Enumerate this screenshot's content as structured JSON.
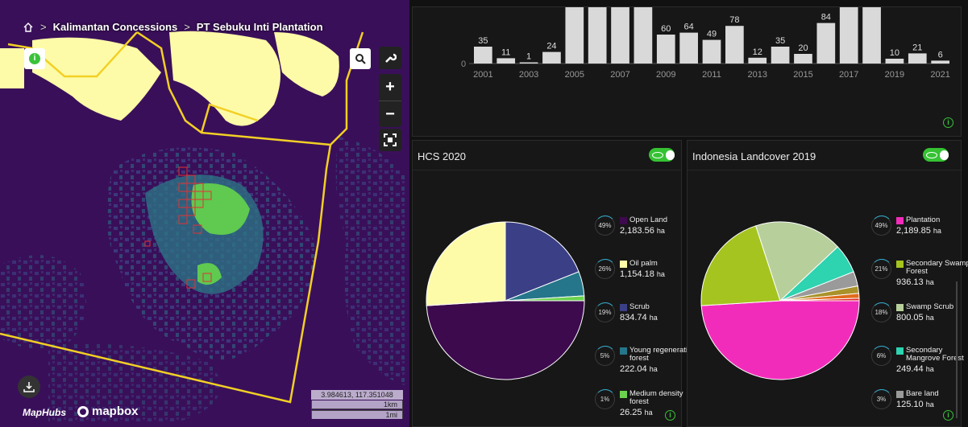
{
  "breadcrumb": {
    "home_icon": "home-icon",
    "items": [
      "Kalimantan Concessions",
      "PT Sebuku Inti Plantation"
    ],
    "separator": ">"
  },
  "map": {
    "coords": "3.984613, 117.351048",
    "scale_km": "1km",
    "scale_mi": "1mi",
    "logo_maphubs": "MapHubs",
    "logo_mapbox": "mapbox",
    "zoom_in": "+",
    "zoom_out": "−",
    "info_label": "i"
  },
  "bar_chart": {
    "chart_data": {
      "type": "bar",
      "categories": [
        "2001",
        "2002",
        "2003",
        "2004",
        "2005",
        "2006",
        "2007",
        "2008",
        "2009",
        "2010",
        "2011",
        "2012",
        "2013",
        "2014",
        "2015",
        "2016",
        "2017",
        "2018",
        "2019",
        "2020",
        "2021"
      ],
      "values": [
        35,
        11,
        1,
        24,
        null,
        null,
        null,
        null,
        60,
        64,
        49,
        78,
        12,
        35,
        20,
        84,
        null,
        null,
        10,
        21,
        6
      ],
      "labels": [
        "35",
        "11",
        "1",
        "24",
        "",
        "",
        "",
        "",
        "60",
        "64",
        "49",
        "78",
        "12",
        "35",
        "20",
        "84",
        "",
        "",
        "10",
        "21",
        "6"
      ],
      "xticks": [
        "2001",
        "2003",
        "2005",
        "2007",
        "2009",
        "2011",
        "2013",
        "2015",
        "2017",
        "2019",
        "2021"
      ],
      "ytick": "0",
      "clipped_note": "bars for 2005–2008 and 2017–2018 exceed visible range"
    }
  },
  "hcs": {
    "title": "HCS 2020",
    "chart_data": {
      "type": "pie",
      "slices": [
        {
          "label": "Open Land",
          "pct": 49,
          "value": "2,183.56",
          "unit": "ha",
          "color": "#3d0a4e"
        },
        {
          "label": "Oil palm",
          "pct": 26,
          "value": "1,154.18",
          "unit": "ha",
          "color": "#fdfba8"
        },
        {
          "label": "Scrub",
          "pct": 19,
          "value": "834.74",
          "unit": "ha",
          "color": "#3b3f86"
        },
        {
          "label": "Young regenerating forest",
          "pct": 5,
          "value": "222.04",
          "unit": "ha",
          "color": "#25768a"
        },
        {
          "label": "Medium density forest",
          "pct": 1,
          "value": "26.25",
          "unit": "ha",
          "color": "#6bd24e"
        }
      ]
    },
    "legend": [
      {
        "pct": "49%",
        "name": "Open Land",
        "value": "2,183.56",
        "unit": "ha"
      },
      {
        "pct": "26%",
        "name": "Oil palm",
        "value": "1,154.18",
        "unit": "ha"
      },
      {
        "pct": "19%",
        "name": "Scrub",
        "value": "834.74",
        "unit": "ha"
      },
      {
        "pct": "5%",
        "name": "Young regenerating forest",
        "value": "222.04",
        "unit": "ha"
      },
      {
        "pct": "1%",
        "name": "Medium density forest",
        "value": "26.25",
        "unit": "ha"
      }
    ]
  },
  "landcover": {
    "title": "Indonesia Landcover 2019",
    "chart_data": {
      "type": "pie",
      "slices": [
        {
          "label": "Plantation",
          "pct": 49,
          "value": "2,189.85",
          "unit": "ha",
          "color": "#f22cba"
        },
        {
          "label": "Secondary Swamp Forest",
          "pct": 21,
          "value": "936.13",
          "unit": "ha",
          "color": "#a5c41f"
        },
        {
          "label": "Swamp Scrub",
          "pct": 18,
          "value": "800.05",
          "unit": "ha",
          "color": "#b7cf9b"
        },
        {
          "label": "Secondary Mangrove Forest",
          "pct": 6,
          "value": "249.44",
          "unit": "ha",
          "color": "#2ed3b0"
        },
        {
          "label": "Bare land",
          "pct": 3,
          "value": "125.10",
          "unit": "ha",
          "color": "#9a9a9a"
        },
        {
          "label": "",
          "pct": 1.5,
          "color": "#a9922a"
        },
        {
          "label": "",
          "pct": 1,
          "color": "#e06b1c"
        },
        {
          "label": "",
          "pct": 0.5,
          "color": "#e12727"
        }
      ]
    },
    "legend": [
      {
        "pct": "49%",
        "name": "Plantation",
        "value": "2,189.85",
        "unit": "ha"
      },
      {
        "pct": "21%",
        "name": "Secondary Swamp Forest",
        "value": "936.13",
        "unit": "ha"
      },
      {
        "pct": "18%",
        "name": "Swamp Scrub",
        "value": "800.05",
        "unit": "ha"
      },
      {
        "pct": "6%",
        "name": "Secondary Mangrove Forest",
        "value": "249.44",
        "unit": "ha"
      },
      {
        "pct": "3%",
        "name": "Bare land",
        "value": "125.10",
        "unit": "ha"
      }
    ]
  },
  "colors": {
    "toggle": "#35c233",
    "info": "#3ac23a",
    "bar": "#d9d9d9",
    "map_bg": "#3a0f5a",
    "boundary": "#f2d024"
  }
}
